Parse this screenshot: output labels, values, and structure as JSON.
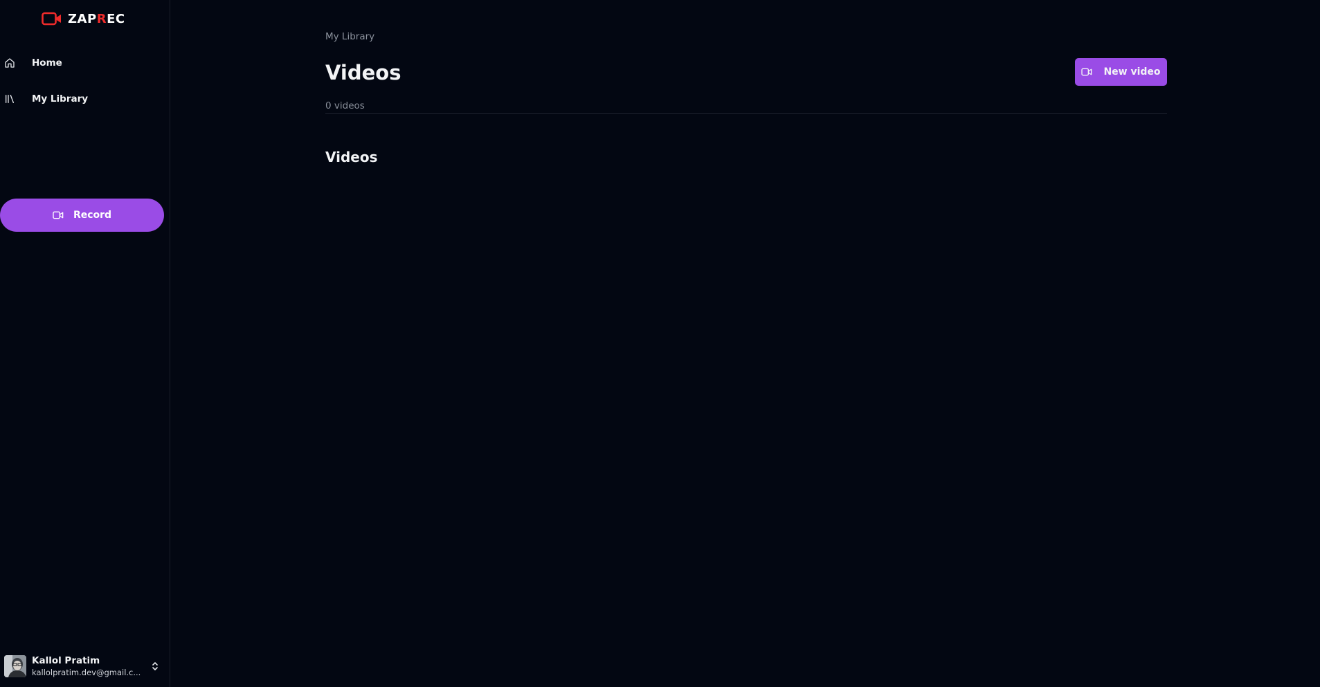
{
  "brand": {
    "name_prefix": "ZAP",
    "name_accent": "R",
    "name_suffix": "EC",
    "accent_color": "#ef2b2b"
  },
  "sidebar": {
    "items": [
      {
        "label": "Home",
        "icon": "home-icon"
      },
      {
        "label": "My Library",
        "icon": "library-icon"
      }
    ],
    "record_label": "Record",
    "record_icon": "video-camera-icon"
  },
  "user": {
    "name": "Kallol Pratim",
    "email": "kallolpratim.dev@gmail.c..."
  },
  "main": {
    "breadcrumb": "My Library",
    "title": "Videos",
    "new_video_label": "New video",
    "count_text": "0 videos",
    "section_title": "Videos"
  },
  "colors": {
    "background": "#030712",
    "accent": "#9a4ce6",
    "muted_text": "#8b919c"
  }
}
